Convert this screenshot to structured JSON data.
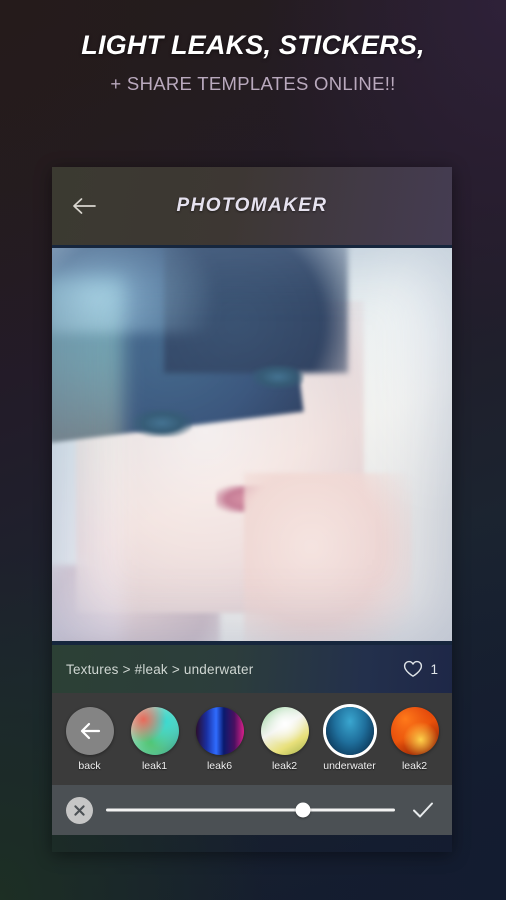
{
  "promo": {
    "title": "LIGHT LEAKS, STICKERS,",
    "subtitle": "+ SHARE TEMPLATES ONLINE!!"
  },
  "app": {
    "title": "PHOTOMAKER",
    "back_icon": "back-arrow-icon"
  },
  "photo": {
    "alt": "portrait photo with blue light leak filter applied"
  },
  "breadcrumb": {
    "text": "Textures > #leak > underwater",
    "favorite_icon": "heart-outline-icon",
    "favorite_count": "1"
  },
  "thumbnails": [
    {
      "label": "back",
      "id": "back",
      "selected": false,
      "icon": "back-arrow-icon"
    },
    {
      "label": "leak1",
      "id": "leak1",
      "selected": false
    },
    {
      "label": "leak6",
      "id": "leak6",
      "selected": false
    },
    {
      "label": "leak2",
      "id": "leak2",
      "selected": false
    },
    {
      "label": "underwater",
      "id": "underwater",
      "selected": true
    },
    {
      "label": "leak2",
      "id": "leak2b",
      "selected": false
    }
  ],
  "slider": {
    "cancel_icon": "close-circle-icon",
    "confirm_icon": "check-icon",
    "value_percent": 68
  },
  "colors": {
    "strip_bg": "#3b3b3b",
    "slider_bg": "#4b5054",
    "selection_ring": "#ffffff",
    "promo_subtitle": "#b9a9bd"
  }
}
